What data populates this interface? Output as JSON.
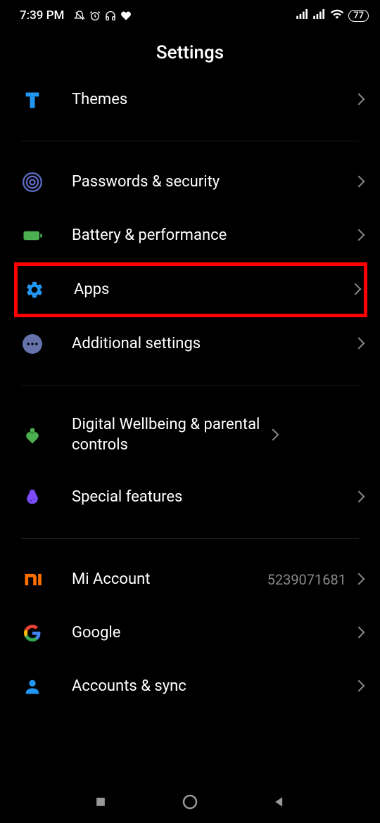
{
  "status": {
    "time": "7:39 PM",
    "battery": "77"
  },
  "header": {
    "title": "Settings"
  },
  "items": [
    {
      "id": "themes",
      "label": "Themes"
    },
    {
      "id": "passwords",
      "label": "Passwords & security"
    },
    {
      "id": "battery",
      "label": "Battery & performance"
    },
    {
      "id": "apps",
      "label": "Apps",
      "highlighted": true
    },
    {
      "id": "additional",
      "label": "Additional settings"
    },
    {
      "id": "wellbeing",
      "label": "Digital Wellbeing & parental controls"
    },
    {
      "id": "special",
      "label": "Special features"
    },
    {
      "id": "miaccount",
      "label": "Mi Account",
      "value": "5239071681"
    },
    {
      "id": "google",
      "label": "Google"
    },
    {
      "id": "accounts",
      "label": "Accounts & sync"
    }
  ]
}
